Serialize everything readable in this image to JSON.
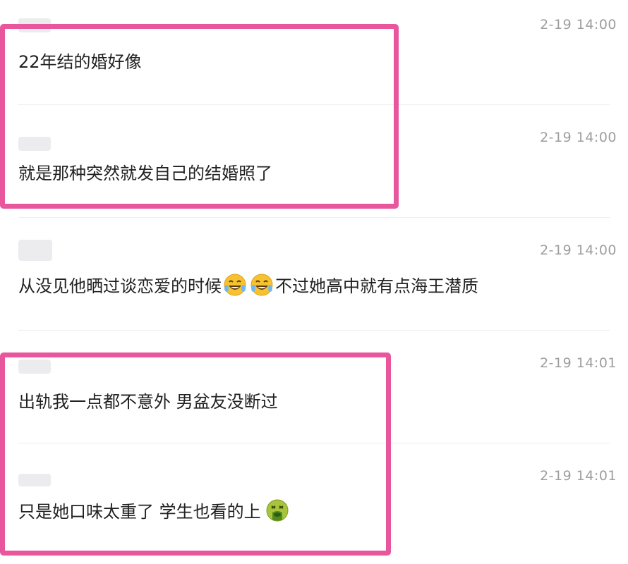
{
  "comments": [
    {
      "time": "2-19 14:00",
      "text": "22年结的婚好像"
    },
    {
      "time": "2-19 14:00",
      "text": "就是那种突然就发自己的结婚照了"
    },
    {
      "time": "2-19 14:00",
      "text_before": "从没见他晒过谈恋爱的时候",
      "text_after": "不过她高中就有点海王潜质",
      "emojis": [
        "laugh-cry-emoji",
        "laugh-cry-emoji"
      ]
    },
    {
      "time": "2-19 14:01",
      "text": "出轨我一点都不意外 男盆友没断过"
    },
    {
      "time": "2-19 14:01",
      "text": "只是她口味太重了 学生也看的上",
      "emojis": [
        "vomit-emoji"
      ]
    }
  ],
  "colors": {
    "highlight": "#e8579e",
    "timestamp": "#9e9e9e",
    "text": "#222222",
    "divider": "#eeeeee"
  }
}
